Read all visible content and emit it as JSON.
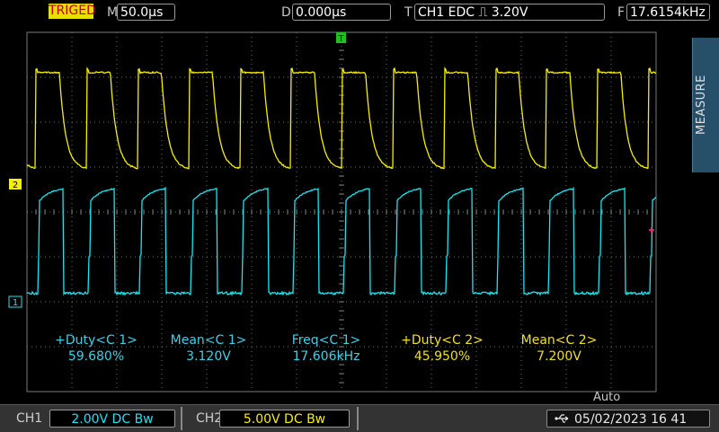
{
  "top": {
    "trigger_status": "TRIGED",
    "timebase_label": "M",
    "timebase_value": "50.0µs",
    "delay_label": "D",
    "delay_value": "0.000µs",
    "trigger_label": "T",
    "trigger_value": "CH1  EDC ⎍  3.20V",
    "freq_label": "F",
    "freq_value": "17.6154kHz"
  },
  "side_menu": {
    "label": "MEASURE"
  },
  "markers": {
    "trigger_position": "T",
    "ch2_marker": "2",
    "ch1_marker": "1"
  },
  "measurements": [
    {
      "title": "+Duty<C 1>",
      "value": "59.680%",
      "color": "#3fd0e6"
    },
    {
      "title": "Mean<C 1>",
      "value": "3.120V",
      "color": "#3fd0e6"
    },
    {
      "title": "Freq<C 1>",
      "value": "17.606kHz",
      "color": "#3fd0e6"
    },
    {
      "title": "+Duty<C 2>",
      "value": "45.950%",
      "color": "#f0e020"
    },
    {
      "title": "Mean<C 2>",
      "value": "7.200V",
      "color": "#f0e020"
    }
  ],
  "acquire_mode": "Auto",
  "bottom": {
    "ch1_label": "CH1",
    "ch1_setting": "2.00V  DC  Bw",
    "ch2_label": "CH2",
    "ch2_setting": "5.00V  DC  Bw",
    "datetime": "05/02/2023 16 41"
  },
  "colors": {
    "ch1": "#19e6f0",
    "ch2": "#f5f000",
    "grid": "#7a7a7a",
    "background": "#000000",
    "trigger_marker": "#20c020",
    "level_marker": "#ff2aa0"
  }
}
